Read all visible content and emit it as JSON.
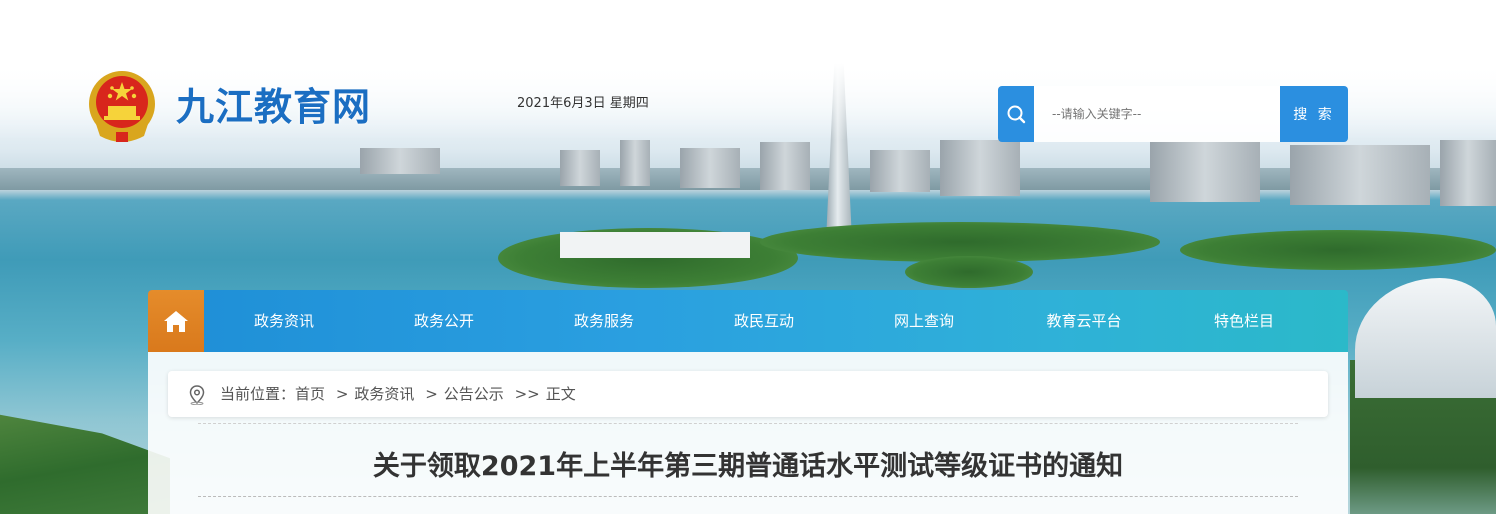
{
  "header": {
    "site_title": "九江教育网",
    "date": "2021年6月3日 星期四",
    "logo_icon": "national-emblem-icon"
  },
  "search": {
    "placeholder": "--请输入关键字--",
    "button_label": "搜 索",
    "icon": "search-icon",
    "accent": "#2b8fe0"
  },
  "nav": {
    "home_icon": "home-icon",
    "home_color": "#e08526",
    "items": [
      {
        "label": "政务资讯"
      },
      {
        "label": "政务公开"
      },
      {
        "label": "政务服务"
      },
      {
        "label": "政民互动"
      },
      {
        "label": "网上查询"
      },
      {
        "label": "教育云平台"
      },
      {
        "label": "特色栏目"
      }
    ]
  },
  "breadcrumb": {
    "icon": "location-pin-icon",
    "prefix": "当前位置：",
    "items": [
      "首页",
      "政务资讯",
      "公告公示",
      "正文"
    ],
    "separators": [
      ">",
      ">",
      ">>"
    ]
  },
  "article": {
    "title": "关于领取2021年上半年第三期普通话水平测试等级证书的通知"
  }
}
